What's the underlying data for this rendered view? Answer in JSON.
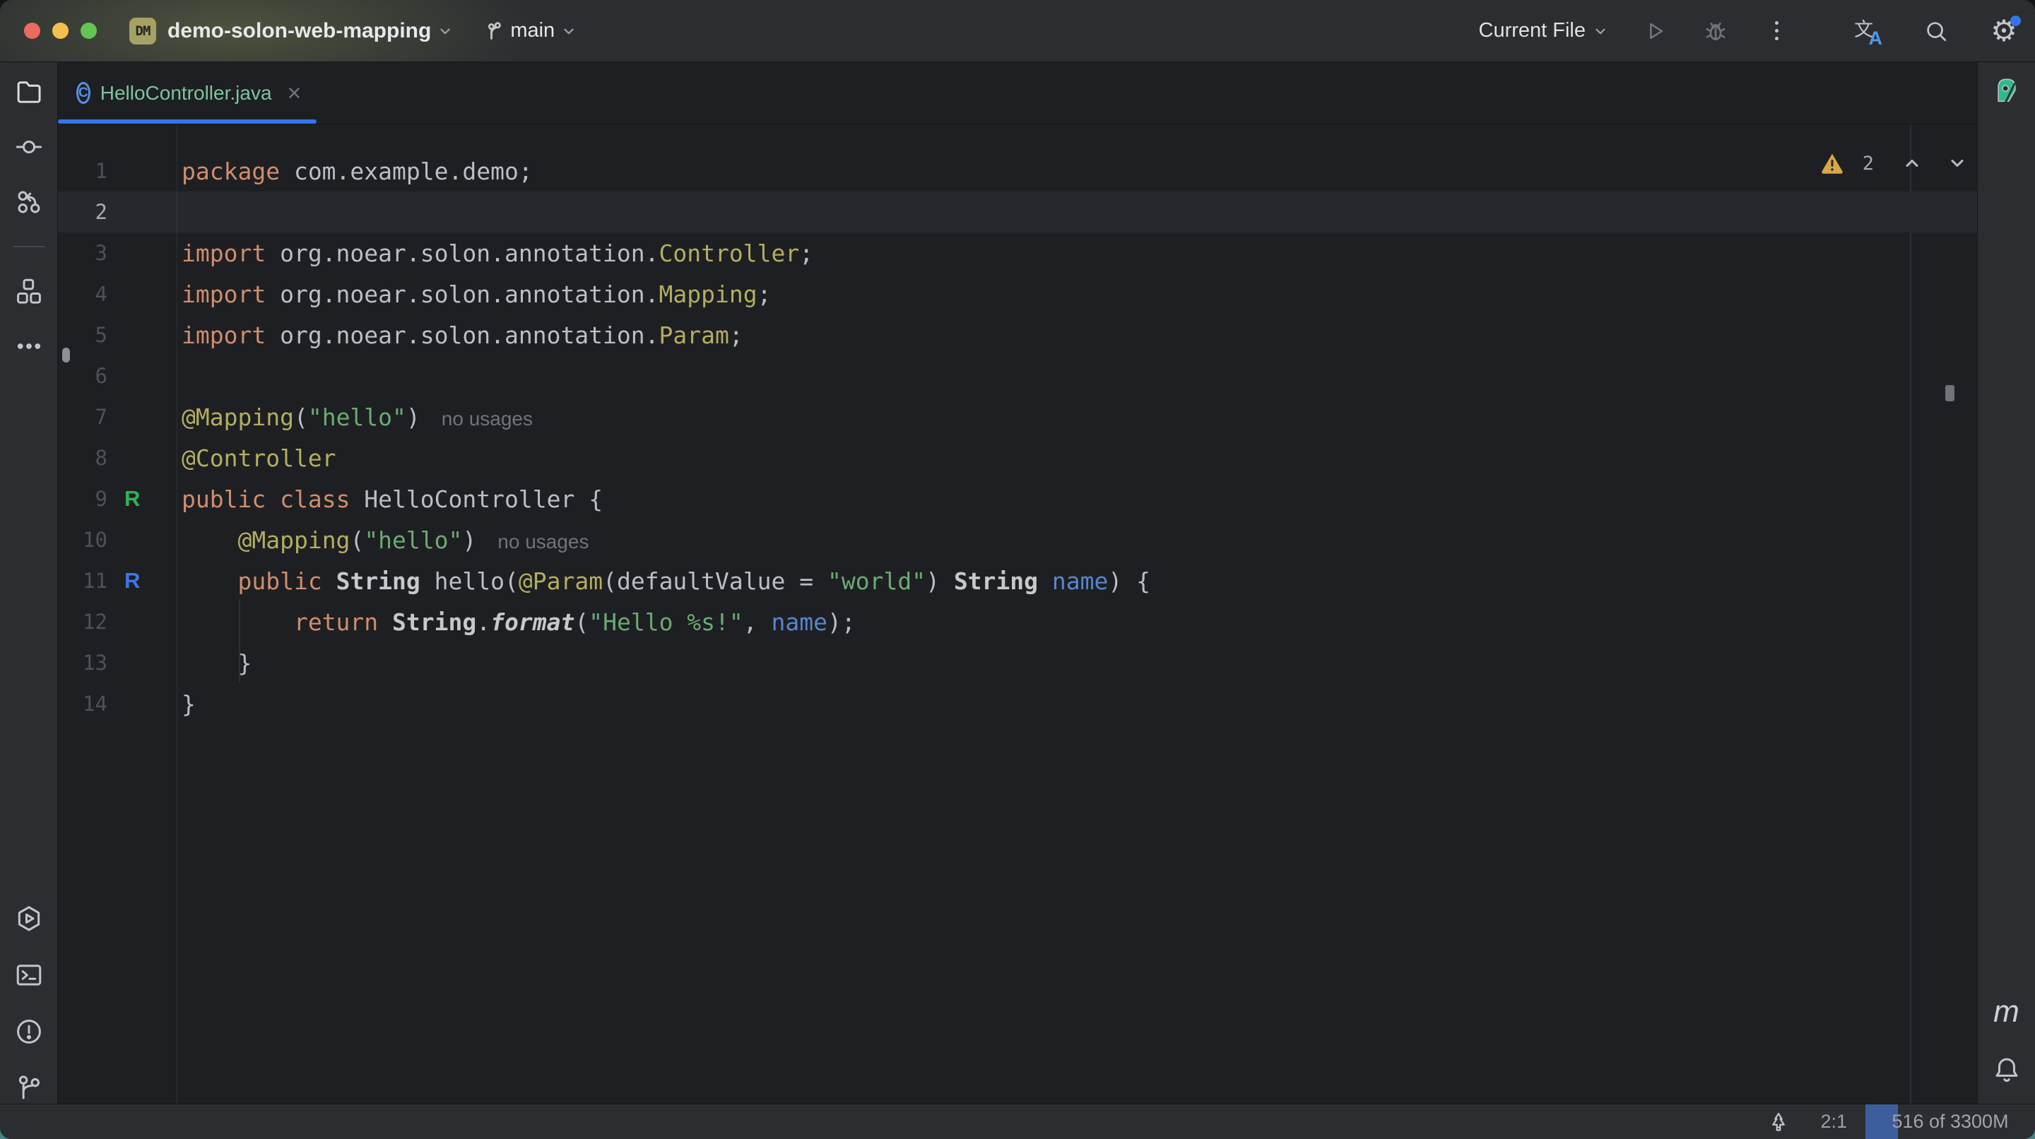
{
  "title_bar": {
    "project_badge": "DM",
    "project_name": "demo-solon-web-mapping",
    "branch_name": "main",
    "run_config_label": "Current File",
    "icons": [
      "project-chevron-down",
      "git-branch-icon",
      "branch-chevron-down",
      "run-icon",
      "debug-icon",
      "kebab-menu-icon",
      "translate-icon",
      "search-icon",
      "settings-gear-icon",
      "notification-dot"
    ]
  },
  "traffic_lights": {
    "close": "#ED6A5E",
    "minimize": "#F5BF4F",
    "zoom": "#62C554"
  },
  "tab_bar": {
    "active_tab": {
      "file_name": "HelloController.java",
      "class_icon_letter": "C",
      "close_label": "×",
      "underline_color": "#3574F0",
      "name_color": "#7EC3A0"
    }
  },
  "left_stripe": {
    "top_icons": [
      "folder-icon",
      "commit-icon",
      "vcs-update-icon",
      "divider",
      "plugins-icon",
      "more-ellipsis-icon"
    ],
    "bottom_icons": [
      "services-icon",
      "terminal-icon",
      "problems-icon",
      "git-icon"
    ]
  },
  "right_stripe": {
    "top_icon": "green-plugin-icon",
    "maven_label": "m",
    "bottom_icons": [
      "maven-icon",
      "notifications-bell-icon"
    ]
  },
  "editor": {
    "caret_line": 2,
    "inspections": {
      "warning_count": "2",
      "icons": [
        "warning-triangle-icon",
        "prev-chevron-up",
        "next-chevron-down"
      ]
    },
    "colors": {
      "keyword": "#CF8E6D",
      "plain": "#BCBEC4",
      "annotation": "#B3AE60",
      "string": "#6AAB73",
      "parameter": "#5786CF",
      "inlay": "#6F737A",
      "caret_line_bg": "#26282E",
      "editor_bg": "#1E1F22",
      "gutter_run_green": "#2CB558",
      "gutter_run_blue": "#3C77E6"
    },
    "lines": [
      {
        "num": "1",
        "tokens": [
          [
            "kw",
            "package"
          ],
          [
            "pl",
            " com.example.demo;"
          ]
        ]
      },
      {
        "num": "2",
        "tokens": []
      },
      {
        "num": "3",
        "tokens": [
          [
            "kw",
            "import"
          ],
          [
            "pl",
            " org.noear.solon.annotation."
          ],
          [
            "an",
            "Controller"
          ],
          [
            "pl",
            ";"
          ]
        ]
      },
      {
        "num": "4",
        "tokens": [
          [
            "kw",
            "import"
          ],
          [
            "pl",
            " org.noear.solon.annotation."
          ],
          [
            "an",
            "Mapping"
          ],
          [
            "pl",
            ";"
          ]
        ]
      },
      {
        "num": "5",
        "tokens": [
          [
            "kw",
            "import"
          ],
          [
            "pl",
            " org.noear.solon.annotation."
          ],
          [
            "an",
            "Param"
          ],
          [
            "pl",
            ";"
          ]
        ]
      },
      {
        "num": "6",
        "tokens": []
      },
      {
        "num": "7",
        "tokens": [
          [
            "an",
            "@Mapping"
          ],
          [
            "pl",
            "("
          ],
          [
            "st",
            "\"hello\""
          ],
          [
            "pl",
            ")"
          ],
          [
            "in",
            "no usages"
          ]
        ]
      },
      {
        "num": "8",
        "tokens": [
          [
            "an",
            "@Controller"
          ]
        ]
      },
      {
        "num": "9",
        "gutter_icon": {
          "letter": "R",
          "color": "#2CB558"
        },
        "tokens": [
          [
            "kw",
            "public"
          ],
          [
            "pl",
            " "
          ],
          [
            "kw",
            "class"
          ],
          [
            "pl",
            " HelloController {"
          ]
        ]
      },
      {
        "num": "10",
        "tokens": [
          [
            "pl",
            "    "
          ],
          [
            "an",
            "@Mapping"
          ],
          [
            "pl",
            "("
          ],
          [
            "st",
            "\"hello\""
          ],
          [
            "pl",
            ")"
          ],
          [
            "in",
            "no usages"
          ]
        ]
      },
      {
        "num": "11",
        "gutter_icon": {
          "letter": "R",
          "color": "#3C77E6"
        },
        "tokens": [
          [
            "pl",
            "    "
          ],
          [
            "kw",
            "public"
          ],
          [
            "pl",
            " "
          ],
          [
            "cl",
            "String"
          ],
          [
            "pl",
            " hello("
          ],
          [
            "an",
            "@Param"
          ],
          [
            "pl",
            "(defaultValue = "
          ],
          [
            "st",
            "\"world\""
          ],
          [
            "pl",
            ") "
          ],
          [
            "cl",
            "String"
          ],
          [
            "pl",
            " "
          ],
          [
            "pr",
            "name"
          ],
          [
            "pl",
            ") {"
          ]
        ]
      },
      {
        "num": "12",
        "tokens": [
          [
            "pl",
            "        "
          ],
          [
            "kw",
            "return"
          ],
          [
            "pl",
            " "
          ],
          [
            "cl",
            "String"
          ],
          [
            "pl",
            "."
          ],
          [
            "fm",
            "format"
          ],
          [
            "pl",
            "("
          ],
          [
            "st",
            "\"Hello %s!\""
          ],
          [
            "pl",
            ", "
          ],
          [
            "pr",
            "name"
          ],
          [
            "pl",
            ");"
          ]
        ]
      },
      {
        "num": "13",
        "tokens": [
          [
            "pl",
            "    }"
          ]
        ]
      },
      {
        "num": "14",
        "tokens": [
          [
            "pl",
            "}"
          ]
        ]
      }
    ]
  },
  "status_bar": {
    "caret_position": "2:1",
    "memory_indicator": "516 of 3300M",
    "icons": [
      "tree-icon"
    ]
  }
}
